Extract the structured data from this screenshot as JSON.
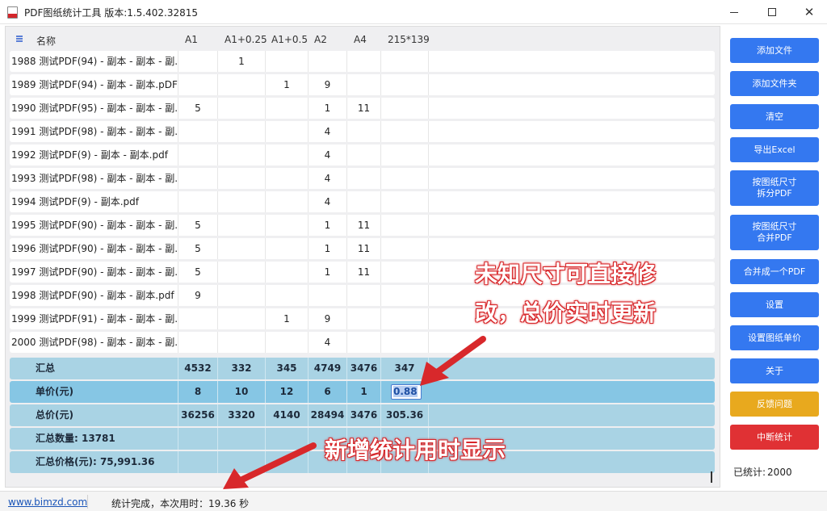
{
  "window": {
    "title": "PDF图纸统计工具 版本:1.5.402.32815",
    "minimize_label": "",
    "close_glyph": "✕"
  },
  "grid": {
    "headers": {
      "name": "名称",
      "a1": "A1",
      "a1p": "A1+0.25",
      "a105": "A1+0.5",
      "a2": "A2",
      "a4": "A4",
      "c215": "215*139"
    },
    "rows": [
      {
        "name": "1988  测试PDF(94) - 副本 - 副本 - 副...",
        "a1": "",
        "a1p": "1",
        "a105": "",
        "a2": "",
        "a4": "",
        "c215": ""
      },
      {
        "name": "1989  测试PDF(94) - 副本 - 副本.pDF",
        "a1": "",
        "a1p": "",
        "a105": "1",
        "a2": "9",
        "a4": "",
        "c215": ""
      },
      {
        "name": "1990  测试PDF(95) - 副本 - 副本 - 副...",
        "a1": "5",
        "a1p": "",
        "a105": "",
        "a2": "1",
        "a4": "11",
        "c215": ""
      },
      {
        "name": "1991  测试PDF(98) - 副本 - 副本 - 副...",
        "a1": "",
        "a1p": "",
        "a105": "",
        "a2": "4",
        "a4": "",
        "c215": ""
      },
      {
        "name": "1992  测试PDF(9) - 副本 - 副本.pdf",
        "a1": "",
        "a1p": "",
        "a105": "",
        "a2": "4",
        "a4": "",
        "c215": ""
      },
      {
        "name": "1993  测试PDF(98) - 副本 - 副本 - 副...",
        "a1": "",
        "a1p": "",
        "a105": "",
        "a2": "4",
        "a4": "",
        "c215": ""
      },
      {
        "name": "1994  测试PDF(9) - 副本.pdf",
        "a1": "",
        "a1p": "",
        "a105": "",
        "a2": "4",
        "a4": "",
        "c215": ""
      },
      {
        "name": "1995  测试PDF(90) - 副本 - 副本 - 副...",
        "a1": "5",
        "a1p": "",
        "a105": "",
        "a2": "1",
        "a4": "11",
        "c215": ""
      },
      {
        "name": "1996  测试PDF(90) - 副本 - 副本 - 副...",
        "a1": "5",
        "a1p": "",
        "a105": "",
        "a2": "1",
        "a4": "11",
        "c215": ""
      },
      {
        "name": "1997  测试PDF(90) - 副本 - 副本 - 副...",
        "a1": "5",
        "a1p": "",
        "a105": "",
        "a2": "1",
        "a4": "11",
        "c215": ""
      },
      {
        "name": "1998  测试PDF(90) - 副本 - 副本.pdf",
        "a1": "9",
        "a1p": "",
        "a105": "",
        "a2": "",
        "a4": "",
        "c215": ""
      },
      {
        "name": "1999  测试PDF(91) - 副本 - 副本 - 副...",
        "a1": "",
        "a1p": "",
        "a105": "1",
        "a2": "9",
        "a4": "",
        "c215": ""
      },
      {
        "name": "2000  测试PDF(98) - 副本 - 副本 - 副...",
        "a1": "",
        "a1p": "",
        "a105": "",
        "a2": "4",
        "a4": "",
        "c215": ""
      }
    ],
    "summary": {
      "total": {
        "label": "汇总",
        "a1": "4532",
        "a1p": "332",
        "a105": "345",
        "a2": "4749",
        "a4": "3476",
        "c215": "347"
      },
      "unit_price": {
        "label": "单价(元)",
        "a1": "8",
        "a1p": "10",
        "a105": "12",
        "a2": "6",
        "a4": "1",
        "c215": "0.88"
      },
      "total_price": {
        "label": "总价(元)",
        "a1": "36256",
        "a1p": "3320",
        "a105": "4140",
        "a2": "28494",
        "a4": "3476",
        "c215": "305.36"
      },
      "total_count": {
        "label": "汇总数量: 13781"
      },
      "total_value": {
        "label": "汇总价格(元): 75,991.36"
      }
    }
  },
  "buttons": [
    {
      "id": "add-file",
      "label": "添加文件"
    },
    {
      "id": "add-folder",
      "label": "添加文件夹"
    },
    {
      "id": "clear",
      "label": "清空"
    },
    {
      "id": "export-excel",
      "label": "导出Excel"
    },
    {
      "id": "split-pdf",
      "label": "按图纸尺寸\n拆分PDF"
    },
    {
      "id": "merge-size-pdf",
      "label": "按图纸尺寸\n合并PDF"
    },
    {
      "id": "merge-one-pdf",
      "label": "合并成一个PDF"
    },
    {
      "id": "settings",
      "label": "设置"
    },
    {
      "id": "set-price",
      "label": "设置图纸单价"
    },
    {
      "id": "about",
      "label": "关于"
    },
    {
      "id": "feedback",
      "label": "反馈问题"
    },
    {
      "id": "stop",
      "label": "中断统计"
    }
  ],
  "counter": {
    "label": "已统计:",
    "value": "2000"
  },
  "status": {
    "link": "www.bimzd.com",
    "text": "统计完成，本次用时：19.36 秒"
  },
  "annotations": {
    "line1": "未知尺寸可直接修",
    "line2": "改，总价实时更新",
    "line3": "新增统计用时显示"
  },
  "colors": {
    "button_blue": "#3478f0",
    "button_feedback": "#e8a91e",
    "button_stop": "#e03134",
    "summary_row": "#a9d3e4",
    "unit_row": "#86c6e4",
    "annotation_red": "#d8282b"
  },
  "icons": [
    "app-icon",
    "header-menu-icon",
    "minimize-icon",
    "maximize-icon",
    "close-icon"
  ]
}
